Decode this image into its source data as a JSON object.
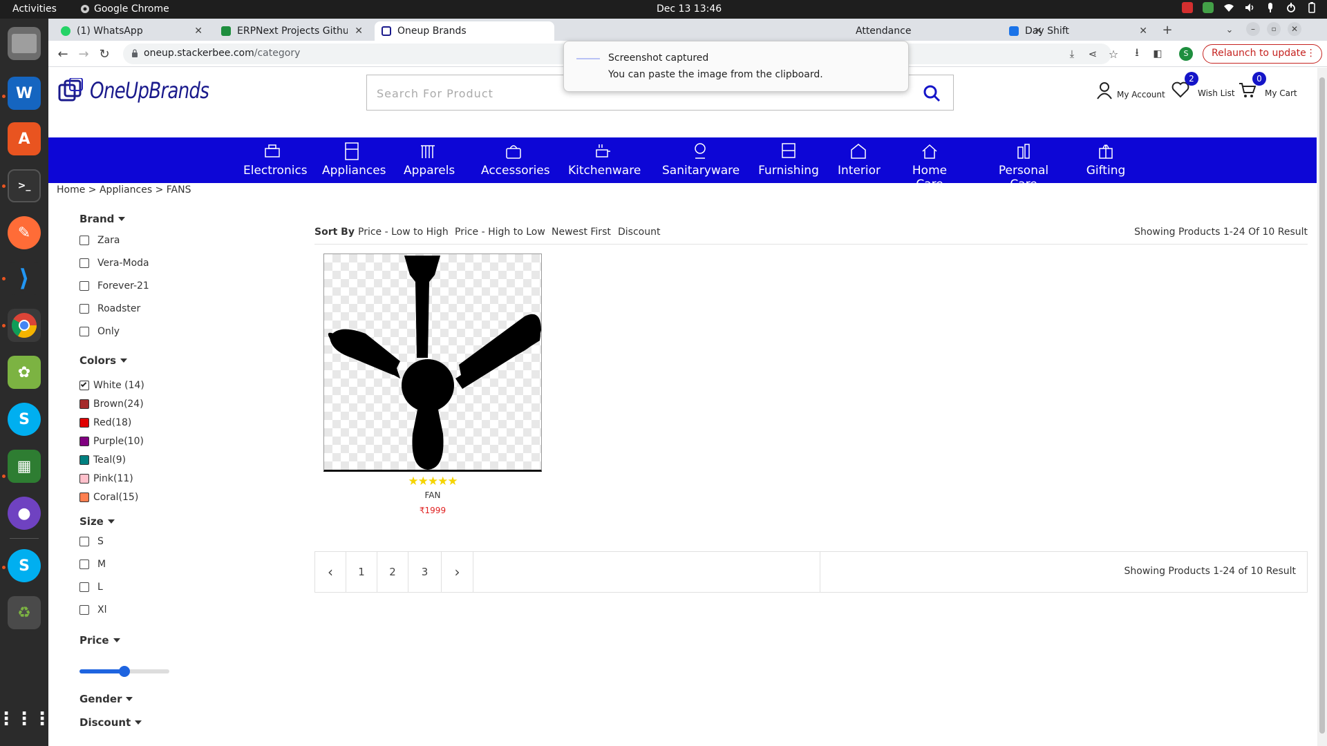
{
  "system": {
    "activities": "Activities",
    "app_name": "Google Chrome",
    "clock": "Dec 13  13:46"
  },
  "tabs": [
    {
      "title": "(1) WhatsApp",
      "color": "#25d366"
    },
    {
      "title": "ERPNext Projects Githu",
      "color": "#1e8e3e"
    },
    {
      "title": "Oneup Brands",
      "color": "#1a1a8c"
    },
    {
      "title": "Attendance",
      "color": "#999999"
    },
    {
      "title": "Day Shift",
      "color": "#1a73e8"
    }
  ],
  "browser": {
    "url_host": "oneup.stackerbee.com",
    "url_path": "/category",
    "relaunch": "Relaunch to update",
    "profile_initial": "S"
  },
  "notification": {
    "title": "Screenshot captured",
    "body": "You can paste the image from the clipboard."
  },
  "header": {
    "logo_text": "OneUpBrands",
    "search_placeholder": "Search For Product",
    "account": "My Account",
    "wishlist": "Wish List",
    "wishlist_count": "2",
    "cart": "My Cart",
    "cart_count": "0"
  },
  "categories": [
    "Electronics",
    "Appliances",
    "Apparels",
    "Accessories",
    "Kitchenware",
    "Sanitaryware",
    "Furnishing",
    "Interior",
    "Home Care",
    "Personal Care",
    "Gifting"
  ],
  "breadcrumb": "Home > Appliances > FANS",
  "filters": {
    "brand_title": "Brand",
    "brands": [
      "Zara",
      "Vera-Moda",
      "Forever-21",
      "Roadster",
      "Only"
    ],
    "colors_title": "Colors",
    "colors": [
      {
        "label": "White  (14)",
        "swatch": "#ffffff",
        "checked": true
      },
      {
        "label": "Brown(24)",
        "swatch": "#a52a2a"
      },
      {
        "label": "Red(18)",
        "swatch": "#e00000"
      },
      {
        "label": "Purple(10)",
        "swatch": "#800080"
      },
      {
        "label": "Teal(9)",
        "swatch": "#008080"
      },
      {
        "label": "Pink(11)",
        "swatch": "#ffc0cb"
      },
      {
        "label": "Coral(15)",
        "swatch": "#ff7f50"
      }
    ],
    "size_title": "Size",
    "sizes": [
      "S",
      "M",
      "L",
      "Xl"
    ],
    "price_title": "Price",
    "price_level": 0.5,
    "gender_title": "Gender",
    "discount_title": "Discount"
  },
  "sort": {
    "label": "Sort By",
    "options": [
      "Price - Low to High",
      "Price - High to Low",
      "Newest First",
      "Discount"
    ],
    "count": "Showing Products 1-24 Of 10 Result"
  },
  "product": {
    "stars": "★★★★★",
    "rating": 5,
    "name": "FAN",
    "price": "₹1999"
  },
  "pagination": {
    "prev": "‹",
    "pages": [
      "1",
      "2",
      "3"
    ],
    "next": "›",
    "count": "Showing Products 1-24 of 10 Result"
  },
  "colors": {
    "brand_blue": "#0d06d6",
    "price_red": "#e02020",
    "star_yellow": "#f5d400"
  }
}
